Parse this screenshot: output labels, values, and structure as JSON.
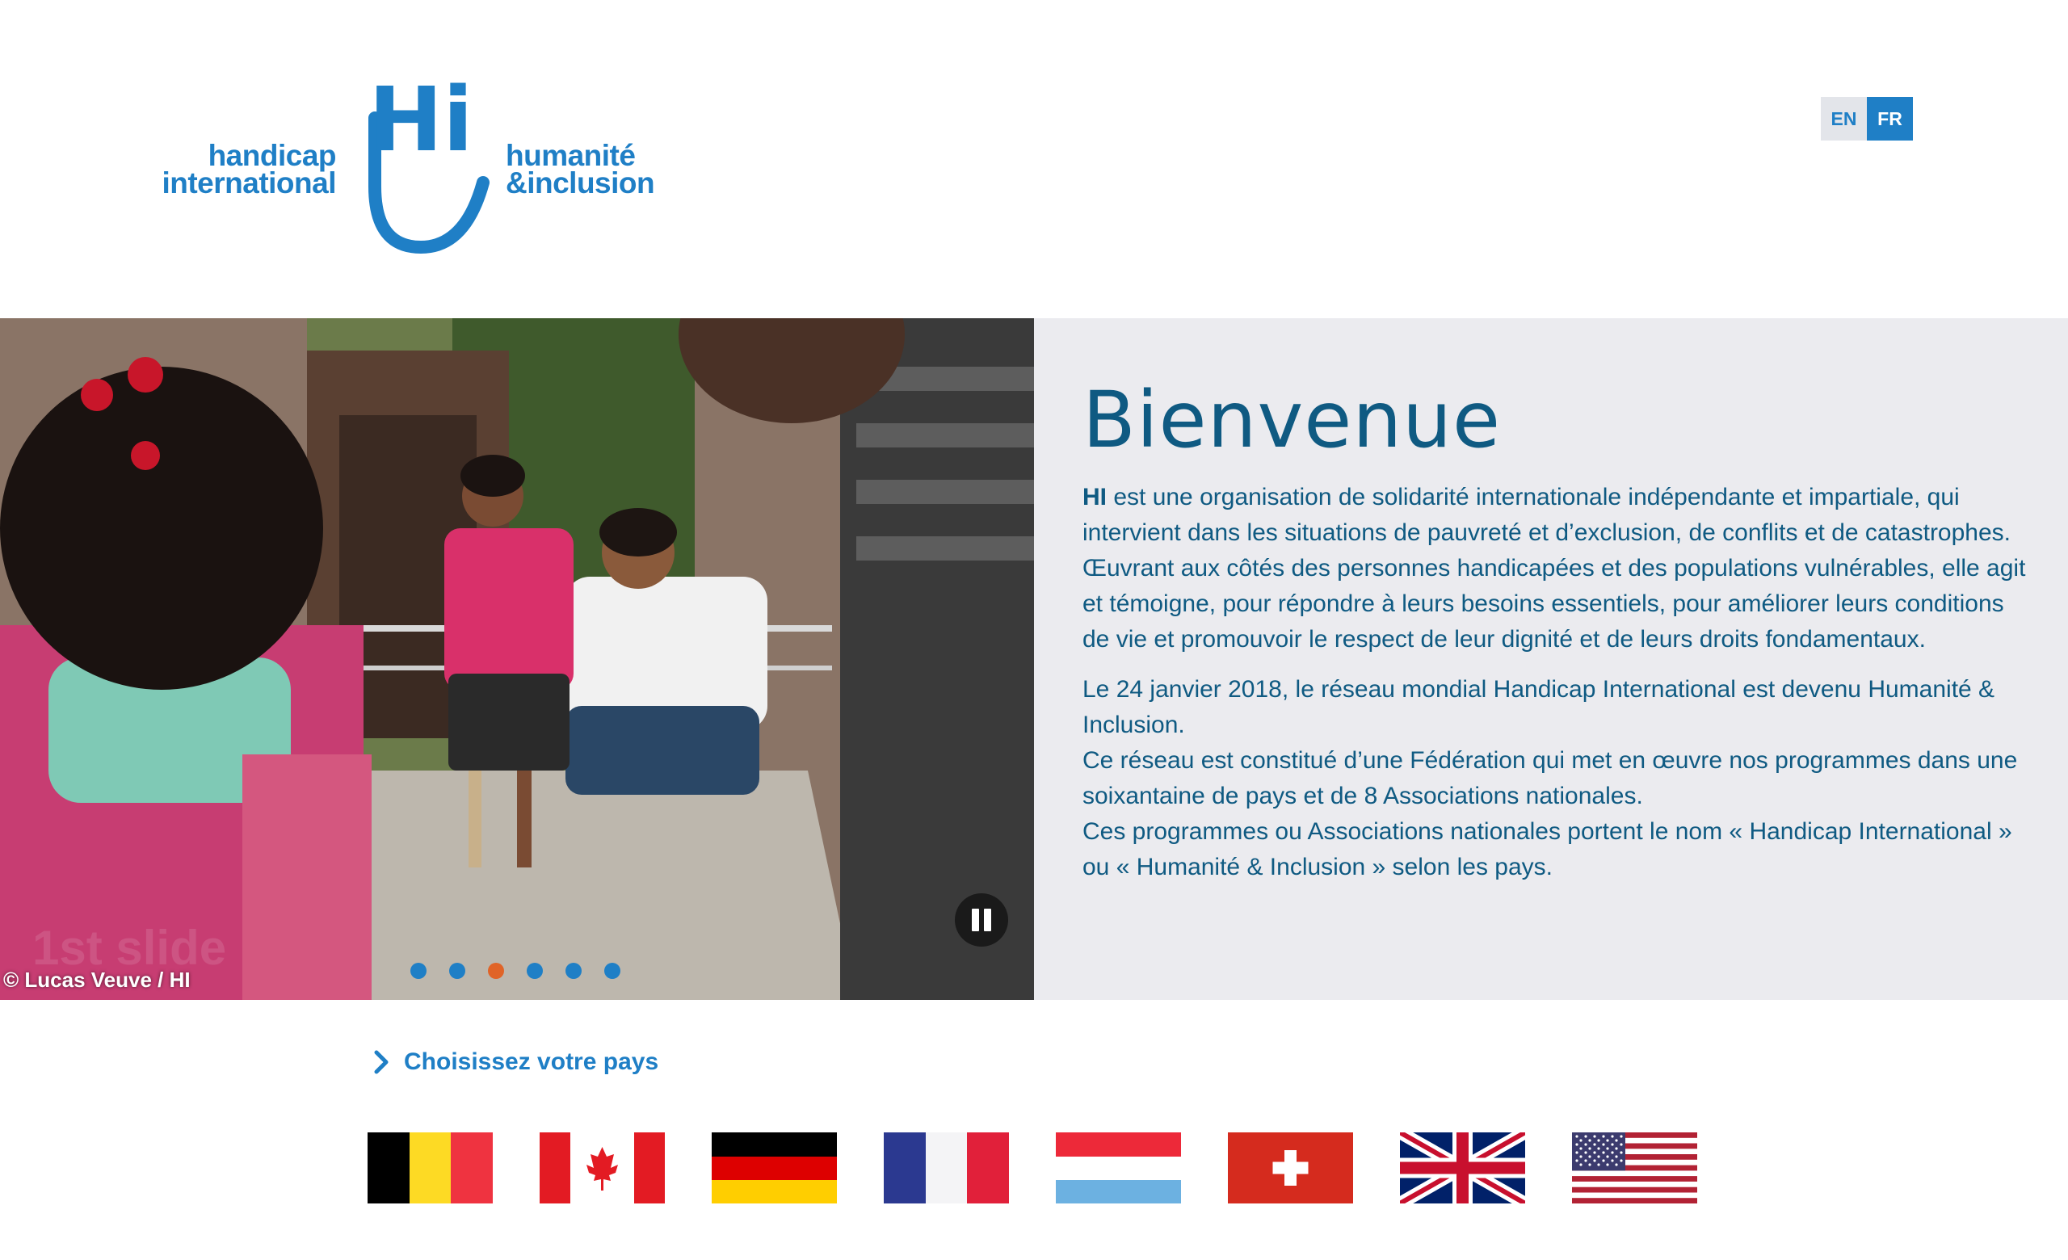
{
  "header": {
    "logo_left_line1": "handicap",
    "logo_left_line2": "international",
    "logo_right_line1": "humanité",
    "logo_right_line2": "&inclusion",
    "logo_mark": "Hi",
    "lang_en": "EN",
    "lang_fr": "FR",
    "active_language": "FR"
  },
  "hero": {
    "photo_credit": "© Lucas Veuve / HI",
    "slides_count": 6,
    "active_slide": 2,
    "title": "Bienvenue",
    "paragraph1_bold": "HI",
    "paragraph1_rest": " est une organisation de solidarité internationale indépendante et impartiale, qui intervient dans les situations de pauvreté et d’exclusion, de conflits et de catastrophes. Œuvrant aux côtés des personnes handicapées et des populations vulnérables, elle agit et témoigne, pour répondre à leurs besoins essentiels, pour améliorer leurs conditions de vie et promouvoir le respect de leur dignité et de leurs droits fondamentaux.",
    "paragraph2_line1": "Le 24 janvier 2018, le réseau mondial Handicap International est devenu Humanité & Inclusion.",
    "paragraph2_line2": "Ce réseau est constitué d’une Fédération qui met en œuvre nos programmes dans une soixantaine de pays et de 8  Associations nationales.",
    "paragraph2_line3": "Ces programmes ou Associations nationales portent le nom « Handicap International » ou « Humanité & Inclusion » selon les pays."
  },
  "country_select": {
    "label": "Choisissez votre pays",
    "flags": [
      "belgium-flag",
      "canada-flag",
      "germany-flag",
      "france-flag",
      "luxembourg-flag",
      "switzerland-flag",
      "united-kingdom-flag",
      "united-states-flag"
    ]
  },
  "colors": {
    "brand_blue": "#1f7fc6",
    "title_blue": "#0f5a82",
    "panel_grey": "#ebebef",
    "active_dot": "#e06428"
  }
}
